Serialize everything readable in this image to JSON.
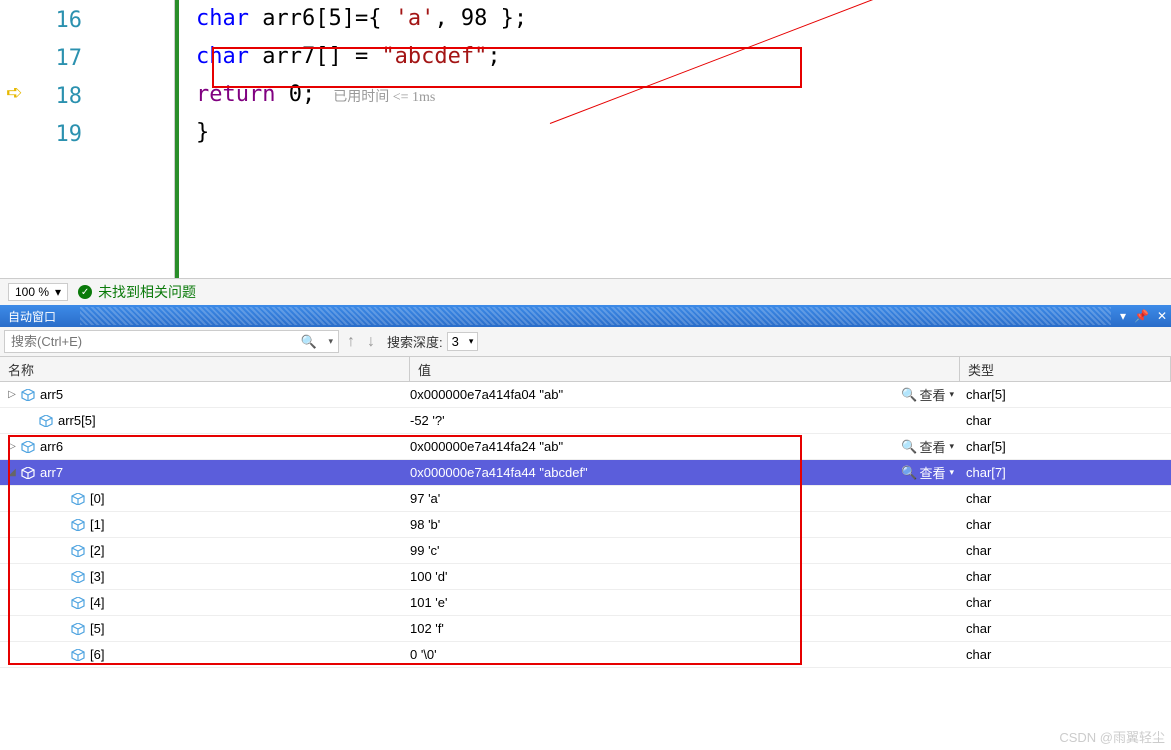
{
  "code": {
    "lines": [
      "16",
      "17",
      "18",
      "19"
    ],
    "l16_kw": "char",
    "l16_rest1": " arr6[5]={ ",
    "l16_ch": "'a'",
    "l16_rest2": ", 98 };",
    "l17_kw": "char",
    "l17_rest1": " arr7[] = ",
    "l17_str": "\"abcdef\"",
    "l17_rest2": ";",
    "l18_kw": "return",
    "l18_rest": " 0;",
    "l18_hint": "已用时间 <= 1ms",
    "l19": "}"
  },
  "status": {
    "zoom": "100 %",
    "msg": "未找到相关问题"
  },
  "panel": {
    "title": "自动窗口",
    "search_placeholder": "搜索(Ctrl+E)",
    "depth_label": "搜索深度:",
    "depth_value": "3",
    "col_name": "名称",
    "col_value": "值",
    "col_type": "类型",
    "view_label": "查看"
  },
  "rows": [
    {
      "indent": 0,
      "exp": "▷",
      "name": "arr5",
      "value": "0x000000e7a414fa04 \"ab\"",
      "type": "char[5]",
      "view": true,
      "sel": false
    },
    {
      "indent": 1,
      "exp": "",
      "name": "arr5[5]",
      "value": "-52 '?'",
      "type": "char",
      "view": false,
      "sel": false
    },
    {
      "indent": 0,
      "exp": "▷",
      "name": "arr6",
      "value": "0x000000e7a414fa24 \"ab\"",
      "type": "char[5]",
      "view": true,
      "sel": false
    },
    {
      "indent": 0,
      "exp": "◢",
      "name": "arr7",
      "value": "0x000000e7a414fa44 \"abcdef\"",
      "type": "char[7]",
      "view": true,
      "sel": true
    },
    {
      "indent": 2,
      "exp": "",
      "name": "[0]",
      "value": "97 'a'",
      "type": "char",
      "view": false,
      "sel": false
    },
    {
      "indent": 2,
      "exp": "",
      "name": "[1]",
      "value": "98 'b'",
      "type": "char",
      "view": false,
      "sel": false
    },
    {
      "indent": 2,
      "exp": "",
      "name": "[2]",
      "value": "99 'c'",
      "type": "char",
      "view": false,
      "sel": false
    },
    {
      "indent": 2,
      "exp": "",
      "name": "[3]",
      "value": "100 'd'",
      "type": "char",
      "view": false,
      "sel": false
    },
    {
      "indent": 2,
      "exp": "",
      "name": "[4]",
      "value": "101 'e'",
      "type": "char",
      "view": false,
      "sel": false
    },
    {
      "indent": 2,
      "exp": "",
      "name": "[5]",
      "value": "102 'f'",
      "type": "char",
      "view": false,
      "sel": false
    },
    {
      "indent": 2,
      "exp": "",
      "name": "[6]",
      "value": "0 '\\0'",
      "type": "char",
      "view": false,
      "sel": false
    }
  ],
  "watermark": "CSDN @雨翼轻尘"
}
